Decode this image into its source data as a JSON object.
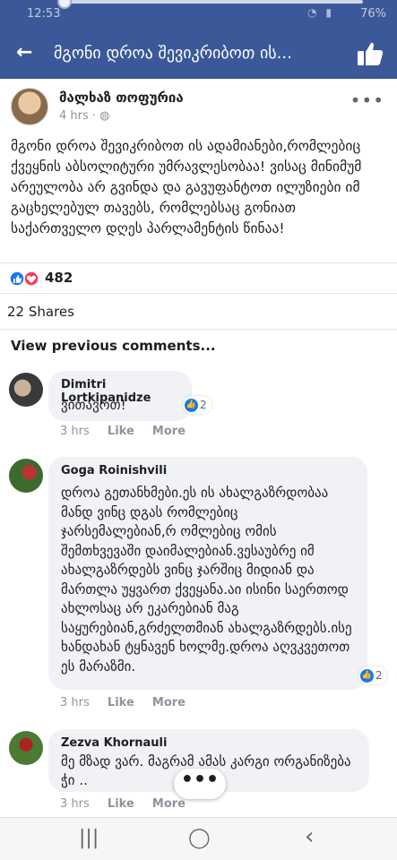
{
  "status_bar": {
    "time": "12:53",
    "battery": "76%"
  },
  "app_bar": {
    "title": "მგონი დროა შევიკრიბოთ ის..."
  },
  "post": {
    "author": "მალხაზ თოფურია",
    "time": "4 hrs",
    "privacy_icon": "globe-icon",
    "body": "მგონი დროა შევიკრიბოთ ის ადამიანები,რომლებიც ქვეყნის აბსოლიტური უმრავლესობაა! ვისაც მინიმუმ არეულობა არ გვინდა და გავუფანტოთ ილუზიები იმ გაცხელებულ თავებს, რომლებსაც გონიათ საქართველო დღეს პარლამენტის წინაა!",
    "reaction_count": "482",
    "shares": "22 Shares"
  },
  "comments": {
    "view_previous": "View previous comments...",
    "items": [
      {
        "name": "Dimitri Lortkipanidze",
        "text": "ვითავოთ!",
        "likes": "2",
        "time": "3 hrs",
        "like_label": "Like",
        "more_label": "More"
      },
      {
        "name": "Goga Roinishvili",
        "text": "დროა გეთანხმები.ეს ის ახალგაზრდობაა მანდ ვინც დგას რომლებიც ჯარსემალებიან,რ ომლებიც ომის შემთხვევაში დაიმალებიან.ვესაუბრე იმ ახალგაზრდებს ვინც ჯარშიც მიდიან და მართლა უყვართ ქვეყანა.აი ისინი საერთოდ ახლოსაც არ ეკარებიან მაგ საყურებიან,გრძელთმიან ახალგაზრდებს.ისე ხანდახან ტყნავენ ხოლმე.დროა აღვკვეთოთ ეს მარაზმი.",
        "likes": "2",
        "time": "3 hrs",
        "like_label": "Like",
        "more_label": "More"
      },
      {
        "name": "Zezva Khornauli",
        "text": "მე მზად ვარ. მაგრამ ამას კარგი ორგანიზება ჭი  ..",
        "time": "3 hrs",
        "like_label": "Like",
        "more_label": "More"
      }
    ]
  },
  "fab": {
    "label": "•••"
  },
  "nav": {
    "recents": "|||",
    "home": "◯",
    "back": "‹"
  },
  "colors": {
    "brand": "#3b5998",
    "like_blue": "#1877f2",
    "love_red": "#f33e58"
  }
}
